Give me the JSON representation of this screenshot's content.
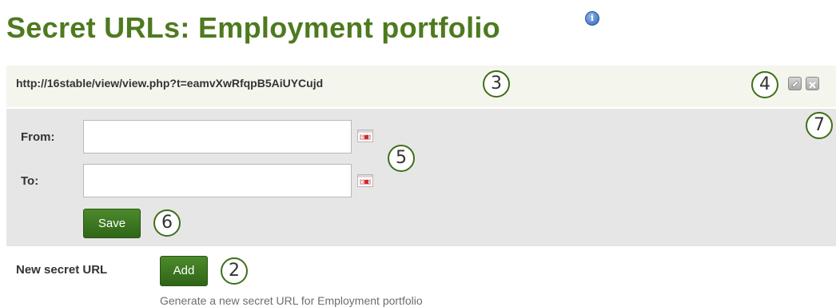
{
  "page": {
    "title": "Secret URLs: Employment portfolio",
    "info_icon": "info-icon"
  },
  "secret_url": {
    "url": "http://16stable/view/view.php?t=eamvXwRfqpB5AiUYCujd",
    "actions": [
      {
        "name": "edit",
        "icon": "pencil-icon"
      },
      {
        "name": "delete",
        "icon": "close-icon"
      }
    ]
  },
  "edit_form": {
    "from_label": "From:",
    "from_value": "",
    "to_label": "To:",
    "to_value": "",
    "calendar_icon": "calendar-icon",
    "save_label": "Save"
  },
  "new_url": {
    "label": "New secret URL",
    "add_label": "Add",
    "description": "Generate a new secret URL for Employment portfolio"
  },
  "callouts": {
    "c2": "2",
    "c3": "3",
    "c4": "4",
    "c5": "5",
    "c6": "6",
    "c7": "7"
  },
  "colors": {
    "title": "#4e7a1f",
    "button": "#3a7421",
    "panel": "#e6e6e6",
    "url_bar": "#f4f6ee"
  }
}
